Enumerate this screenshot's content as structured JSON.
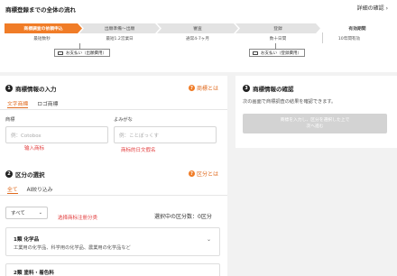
{
  "flow": {
    "title": "商標登録までの全体の流れ",
    "detail_link": "詳細の確認",
    "steps": [
      {
        "label": "商標調査の依頼申込",
        "sub": "最短数秒"
      },
      {
        "label": "出願準備～出願",
        "sub": "最短1.2営業日"
      },
      {
        "label": "審査",
        "sub": "通常4-7ヶ月"
      },
      {
        "label": "登録",
        "sub": "数十日間"
      },
      {
        "label": "有効期間",
        "sub": "10年間有効"
      }
    ],
    "payments": [
      "お支払い（出願費用）",
      "お支払い（登録費用）"
    ]
  },
  "trademark_info": {
    "number": "1",
    "title": "商標情報の入力",
    "help": "商標とは",
    "tabs": [
      "文字商標",
      "ロゴ商標"
    ],
    "mark_label": "商標",
    "mark_placeholder": "例：Cotobox",
    "mark_note": "输入商标",
    "reading_label": "よみがな",
    "reading_placeholder": "例：ことぼっくす",
    "reading_note": "商标的日文假名"
  },
  "classification": {
    "number": "2",
    "title": "区分の選択",
    "help": "区分とは",
    "tabs": [
      "全て",
      "AI絞り込み"
    ],
    "filter_value": "すべて",
    "filter_note": "选择商标注册分类",
    "selected_count": "選択中の区分数：0区分",
    "categories": [
      {
        "name": "1類 化学品",
        "desc": "工業用の化学品、科学用の化学品、農業用の化学品など"
      },
      {
        "name": "2類 塗料・着色料",
        "desc": ""
      }
    ]
  },
  "confirm": {
    "number": "3",
    "title": "商標情報の確認",
    "desc": "次の画面で商標調査の結果を確認できます。",
    "button_line1": "商標を入力し、区分を選択した上で",
    "button_line2": "次へ進む"
  },
  "colors": {
    "accent": "#f07c27",
    "note_red": "#e23a3a"
  },
  "icons": [
    "chevron-right-icon",
    "card-icon",
    "help-circle-icon",
    "chevron-down-icon"
  ]
}
